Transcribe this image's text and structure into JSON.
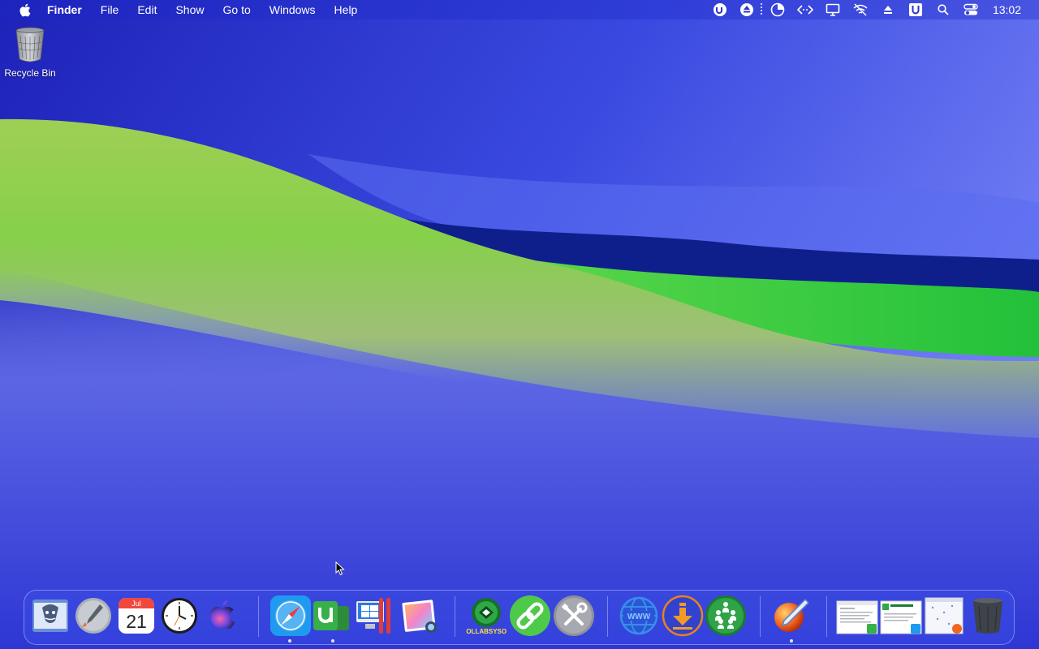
{
  "menubar": {
    "app_name": "Finder",
    "menus": [
      "File",
      "Edit",
      "Show",
      "Go to",
      "Windows",
      "Help"
    ],
    "clock": "13:02"
  },
  "desktop": {
    "recycle_bin_label": "Recycle Bin"
  },
  "dock": {
    "calendar": {
      "month": "Jul",
      "day": "21"
    },
    "collabsysos_label": "COLLABSYSOS",
    "web_label": "WWW"
  }
}
